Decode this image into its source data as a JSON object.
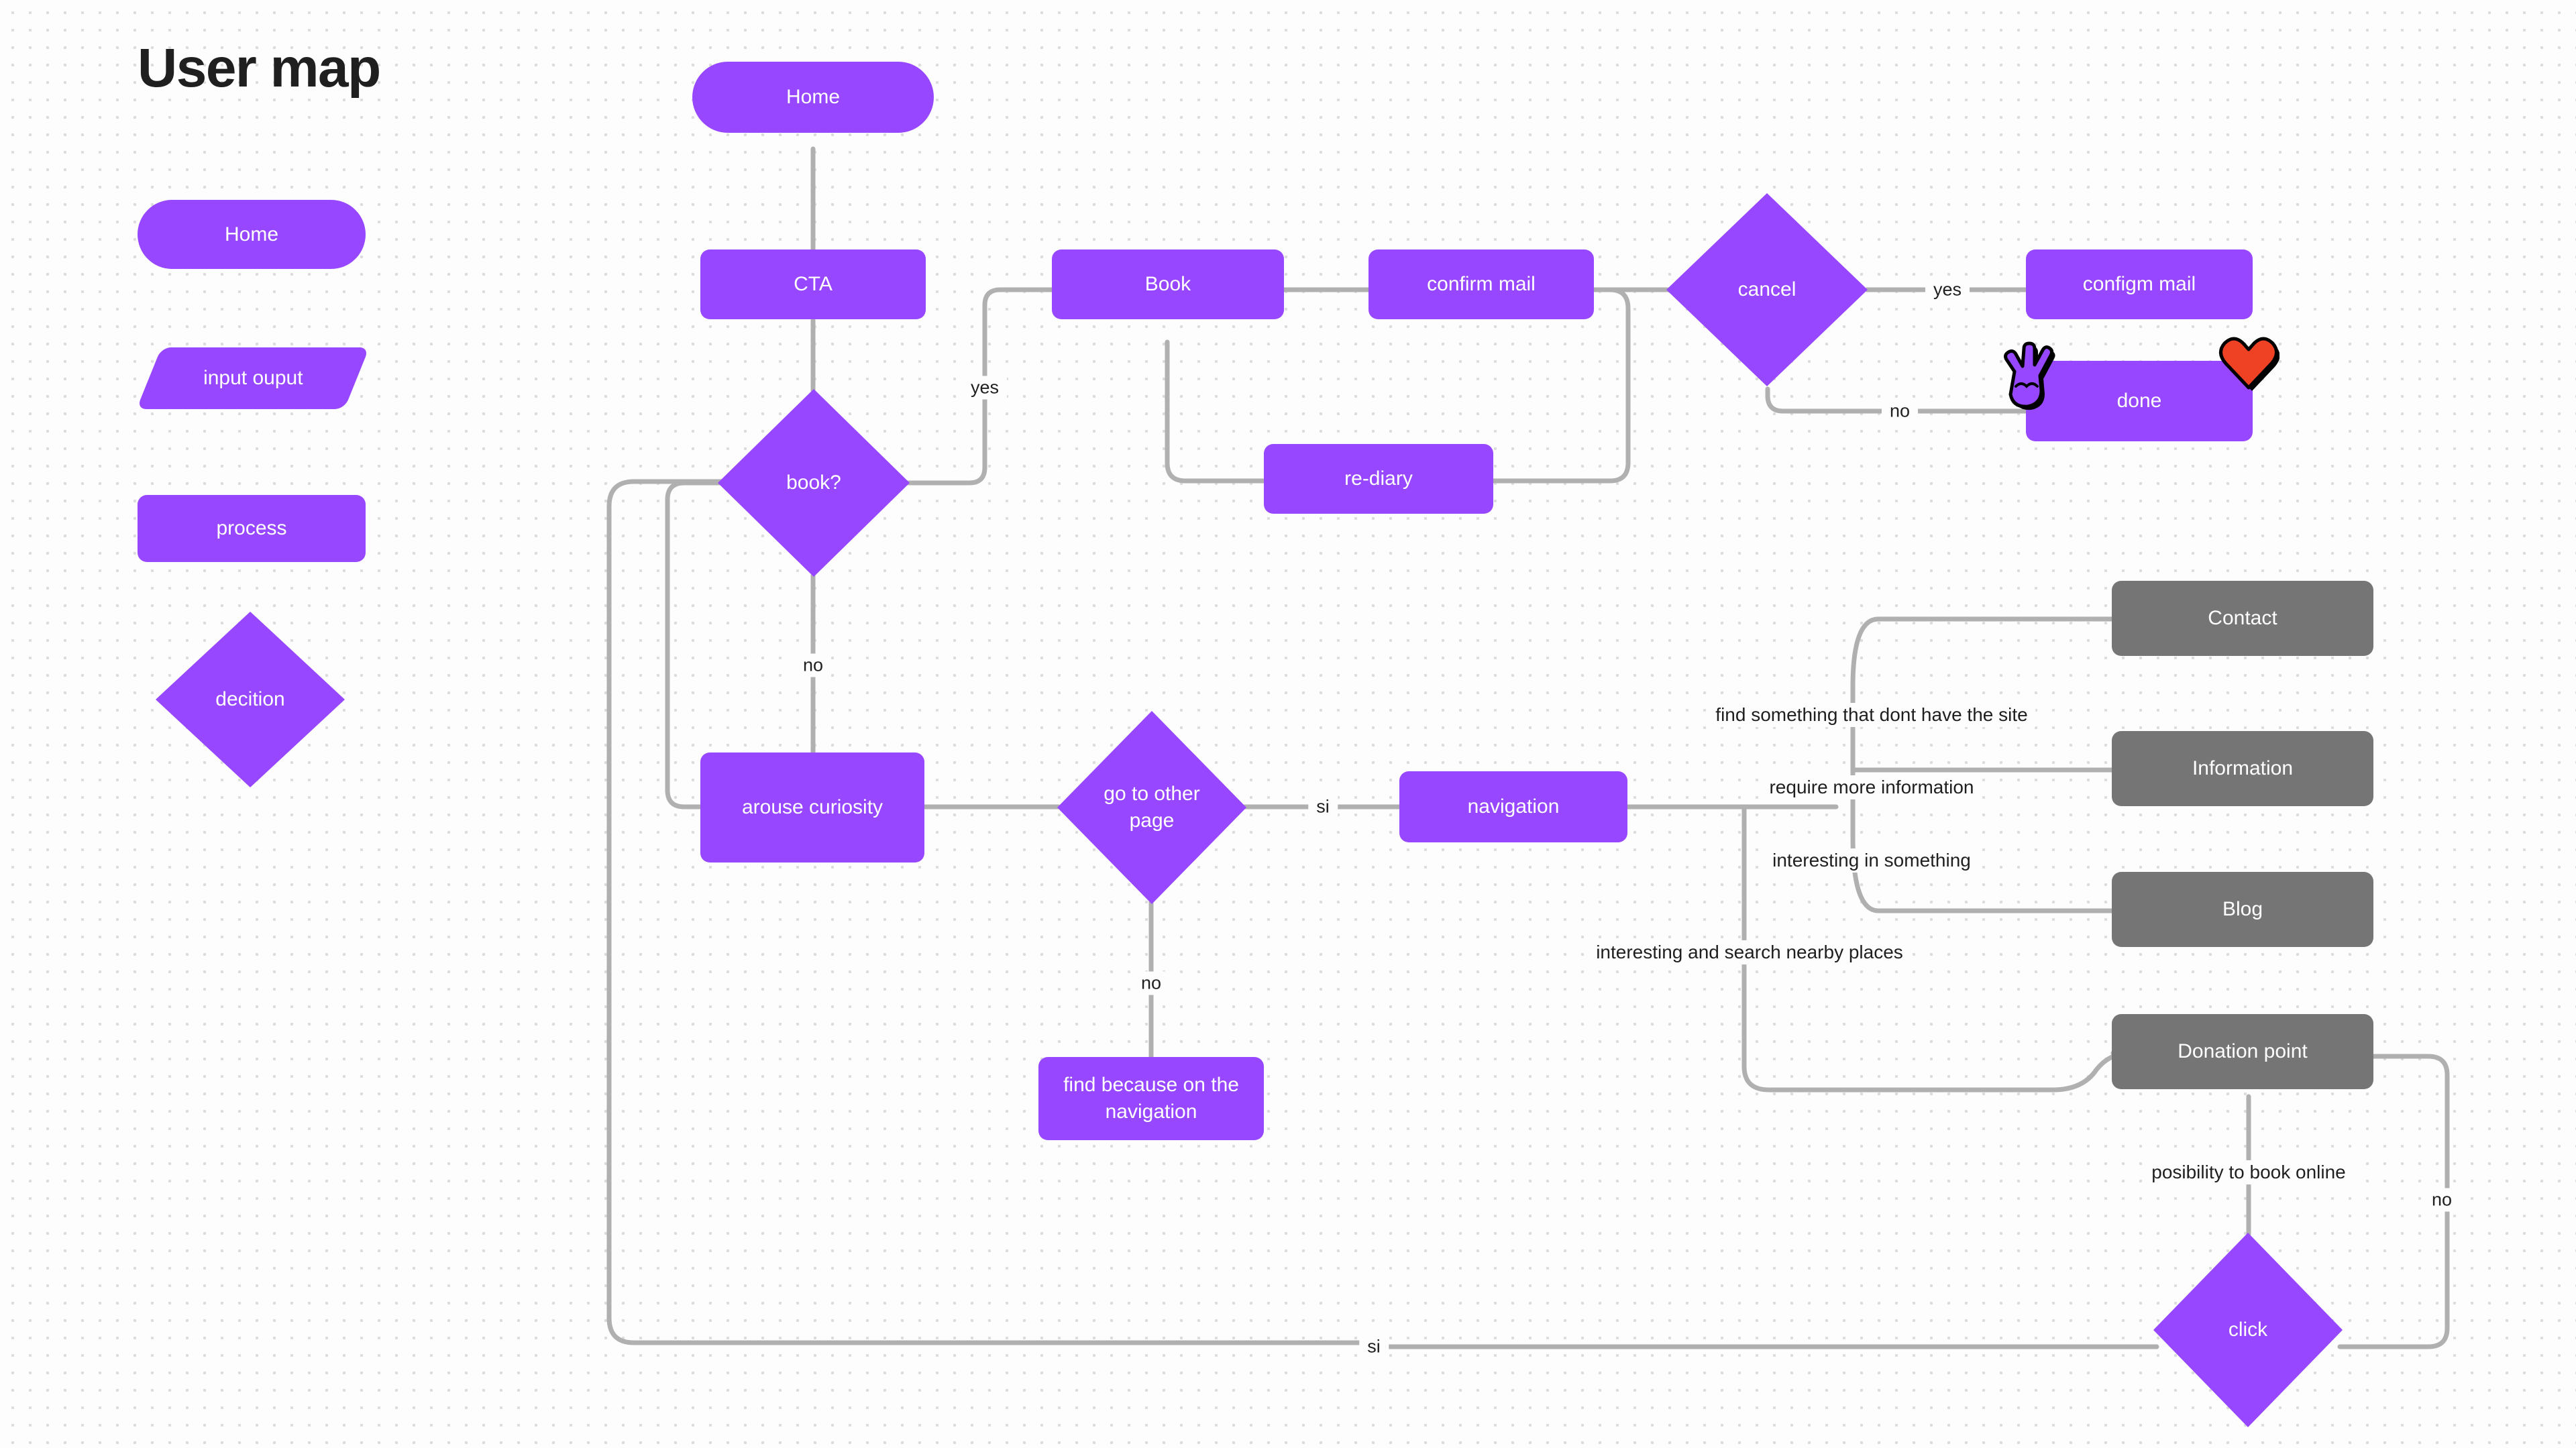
{
  "page": {
    "title": "User map",
    "background_color": "#fdfdfd",
    "accent_color": "#9747ff",
    "secondary_color": "#757575",
    "edge_color": "#b0b0b0"
  },
  "legend": {
    "items": [
      {
        "label": "Home",
        "shape": "pill"
      },
      {
        "label": "input ouput",
        "shape": "parallelogram"
      },
      {
        "label": "process",
        "shape": "rounded-rect"
      },
      {
        "label": "decition",
        "shape": "diamond"
      }
    ]
  },
  "nodes": [
    {
      "id": "home",
      "label": "Home",
      "shape": "pill",
      "color": "purple"
    },
    {
      "id": "cta",
      "label": "CTA",
      "shape": "rounded-rect",
      "color": "purple"
    },
    {
      "id": "book_q",
      "label": "book?",
      "shape": "diamond",
      "color": "purple"
    },
    {
      "id": "book",
      "label": "Book",
      "shape": "rounded-rect",
      "color": "purple"
    },
    {
      "id": "confirm_mail",
      "label": "confirm mail",
      "shape": "rounded-rect",
      "color": "purple"
    },
    {
      "id": "re_diary",
      "label": "re-diary",
      "shape": "rounded-rect",
      "color": "purple"
    },
    {
      "id": "cancel",
      "label": "cancel",
      "shape": "diamond",
      "color": "purple"
    },
    {
      "id": "configm_mail",
      "label": "configm mail",
      "shape": "rounded-rect",
      "color": "purple"
    },
    {
      "id": "done",
      "label": "done",
      "shape": "rounded-rect",
      "color": "purple"
    },
    {
      "id": "arouse",
      "label": "arouse curiosity",
      "shape": "rounded-rect",
      "color": "purple"
    },
    {
      "id": "goto_other",
      "label": "go to other page",
      "shape": "diamond",
      "color": "purple"
    },
    {
      "id": "navigation",
      "label": "navigation",
      "shape": "rounded-rect",
      "color": "purple"
    },
    {
      "id": "find_nav",
      "label": "find because on the navigation",
      "shape": "rounded-rect",
      "color": "purple"
    },
    {
      "id": "contact",
      "label": "Contact",
      "shape": "rounded-rect",
      "color": "gray"
    },
    {
      "id": "information",
      "label": "Information",
      "shape": "rounded-rect",
      "color": "gray"
    },
    {
      "id": "blog",
      "label": "Blog",
      "shape": "rounded-rect",
      "color": "gray"
    },
    {
      "id": "donation",
      "label": "Donation point",
      "shape": "rounded-rect",
      "color": "gray"
    },
    {
      "id": "click",
      "label": "click",
      "shape": "diamond",
      "color": "purple"
    }
  ],
  "edge_labels": [
    {
      "id": "book_yes",
      "text": "yes"
    },
    {
      "id": "book_no",
      "text": "no"
    },
    {
      "id": "cancel_yes",
      "text": "yes"
    },
    {
      "id": "cancel_no",
      "text": "no"
    },
    {
      "id": "goto_si",
      "text": "si"
    },
    {
      "id": "goto_no",
      "text": "no"
    },
    {
      "id": "bottom_si",
      "text": "si"
    },
    {
      "id": "click_no",
      "text": "no"
    },
    {
      "id": "contact_lbl",
      "text": "find something that dont have the site"
    },
    {
      "id": "info_lbl",
      "text": "require more information"
    },
    {
      "id": "blog_lbl",
      "text": "interesting in something"
    },
    {
      "id": "donate_lbl",
      "text": "interesting and search nearby places"
    },
    {
      "id": "book_online",
      "text": "posibility to book online"
    }
  ],
  "stickers": [
    {
      "id": "peace-hand-sticker",
      "glyph": "✌",
      "color": "#9747ff"
    },
    {
      "id": "heart-sticker",
      "glyph": "♥",
      "color": "#ef4123"
    }
  ]
}
